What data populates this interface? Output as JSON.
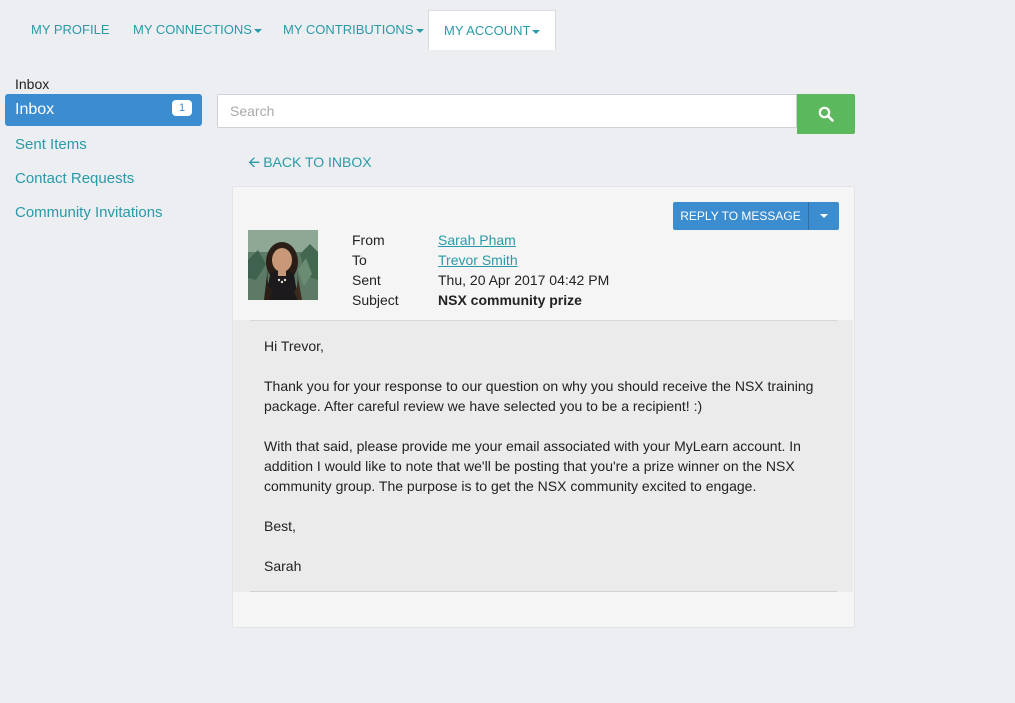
{
  "nav": {
    "tabs": [
      {
        "label": "MY PROFILE",
        "caret": false
      },
      {
        "label": "MY CONNECTIONS",
        "caret": true
      },
      {
        "label": "MY CONTRIBUTIONS",
        "caret": true
      },
      {
        "label": "MY ACCOUNT",
        "caret": true,
        "active": true
      }
    ]
  },
  "sidebar": {
    "heading": "Inbox",
    "items": [
      {
        "label": "Inbox",
        "badge": "1",
        "active": true
      },
      {
        "label": "Sent Items"
      },
      {
        "label": "Contact Requests"
      },
      {
        "label": "Community Invitations"
      }
    ]
  },
  "search": {
    "placeholder": "Search",
    "icon": "search-icon"
  },
  "back_link": {
    "label": "BACK TO INBOX",
    "icon": "arrow-left-icon"
  },
  "message": {
    "reply_label": "REPLY TO MESSAGE",
    "from_label": "From",
    "from": "Sarah Pham",
    "to_label": "To",
    "to": "Trevor Smith",
    "sent_label": "Sent",
    "sent": "Thu, 20 Apr 2017 04:42 PM",
    "subject_label": "Subject",
    "subject": "NSX community prize",
    "body": {
      "greeting": "Hi Trevor,",
      "para1_line1": "Thank you for your response to our question on why you should receive the NSX training",
      "para1_line2": "package. After careful review we have selected you to be a recipient! :)",
      "para2_line1": "With that said, please provide me your email associated with your MyLearn account. In",
      "para2_line2": "addition I would like to note that we'll be posting that you're a prize winner on the NSX",
      "para2_line3": "community group. The purpose is to get the NSX community excited to engage.",
      "closing": "Best,",
      "signature": "Sarah"
    }
  },
  "colors": {
    "accent": "#2a9aa8",
    "primary": "#3b8dd0",
    "success": "#5cb85c",
    "background": "#eceef2"
  }
}
